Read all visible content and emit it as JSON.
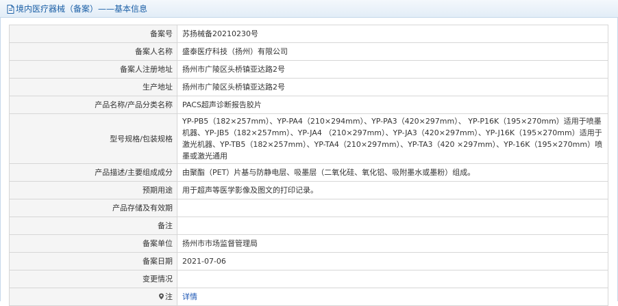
{
  "header": {
    "title": "境内医疗器械（备案）——基本信息"
  },
  "rows": [
    {
      "label": "备案号",
      "value": "苏扬械备20210230号"
    },
    {
      "label": "备案人名称",
      "value": "盛泰医疗科技（扬州）有限公司"
    },
    {
      "label": "备案人注册地址",
      "value": "扬州市广陵区头桥镇亚达路2号"
    },
    {
      "label": "生产地址",
      "value": "扬州市广陵区头桥镇亚达路2号"
    },
    {
      "label": "产品名称/产品分类名称",
      "value": "PACS超声诊断报告胶片"
    },
    {
      "label": "型号规格/包装规格",
      "value": "YP-PB5（182×257mm）、YP-PA4（210×294mm）、YP-PA3（420×297mm）、 YP-P16K（195×270mm）适用于喷墨机器、YP-JB5（182×257mm）、YP-JA4 （210×297mm）、YP-JA3（420×297mm）、YP-J16K（195×270mm）适用于 激光机器、YP-TB5（182×257mm）、YP-TA4（210×297mm）、YP-TA3（420 ×297mm）、YP-16K（195×270mm）喷墨或激光通用"
    },
    {
      "label": "产品描述/主要组成成分",
      "value": "由聚酯（PET）片基与防静电层、吸墨层（二氧化硅、氧化铝、吸附墨水或墨粉）组成。"
    },
    {
      "label": "预期用途",
      "value": "用于超声等医学影像及图文的打印记录。"
    },
    {
      "label": "产品存储及有效期",
      "value": ""
    },
    {
      "label": "备注",
      "value": ""
    },
    {
      "label": "备案单位",
      "value": "扬州市市场监督管理局"
    },
    {
      "label": "备案日期",
      "value": "2021-07-06"
    },
    {
      "label": "变更情况",
      "value": ""
    },
    {
      "label": "注",
      "value": "详情",
      "icon": "map-pin-icon"
    }
  ],
  "colors": {
    "link": "#1a55b4",
    "header_text": "#1b5fa6",
    "label_bg": "#f5f5f5",
    "border": "#d6d6d6"
  }
}
